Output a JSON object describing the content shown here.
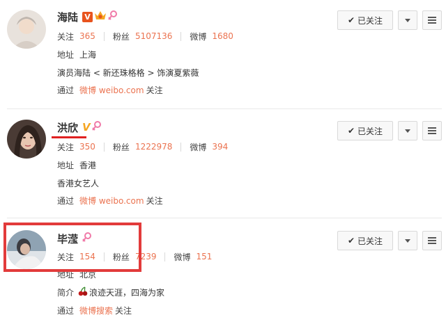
{
  "users": [
    {
      "name": "海陆",
      "verified": "V",
      "stats": {
        "following_label": "关注",
        "following": "365",
        "fans_label": "粉丝",
        "fans": "5107136",
        "weibo_label": "微博",
        "weibo": "1680"
      },
      "location_label": "地址",
      "location": "上海",
      "bio": "演员海陆 < 新还珠格格 > 饰演夏紫薇",
      "source_prefix": "通过",
      "source_link": "微博 weibo.com",
      "source_suffix": "关注",
      "follow_label": "已关注"
    },
    {
      "name": "洪欣",
      "verified": "V",
      "stats": {
        "following_label": "关注",
        "following": "350",
        "fans_label": "粉丝",
        "fans": "1222978",
        "weibo_label": "微博",
        "weibo": "394"
      },
      "location_label": "地址",
      "location": "香港",
      "bio": "香港女艺人",
      "source_prefix": "通过",
      "source_link": "微博 weibo.com",
      "source_suffix": "关注",
      "follow_label": "已关注"
    },
    {
      "name": "毕滢",
      "stats": {
        "following_label": "关注",
        "following": "154",
        "fans_label": "粉丝",
        "fans": "7239",
        "weibo_label": "微博",
        "weibo": "151"
      },
      "location_label": "地址",
      "location": "北京",
      "intro_label": "简介",
      "intro": "浪迹天涯，四海为家",
      "source_prefix": "通过",
      "source_link": "微博搜索",
      "source_suffix": "关注",
      "follow_label": "已关注"
    }
  ],
  "colors": {
    "accent": "#eb7350",
    "verified": "#e8541e",
    "highlight": "#e02020"
  }
}
